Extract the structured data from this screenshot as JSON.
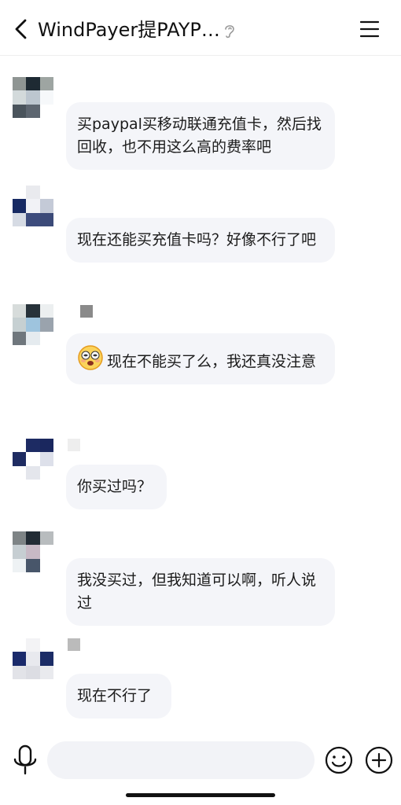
{
  "header": {
    "title": "WindPayer提PAYP…"
  },
  "messages": [
    {
      "text": "买paypal买移动联通充值卡，然后找回收，也不用这么高的费率吧",
      "avatar_colors": [
        "#8f9593",
        "#1e2a33",
        "#9ea5a2",
        "#d3dadb",
        "#bcc6cf",
        "#f6f8fa",
        "#4a545c",
        "#5d6670",
        "#ffffff"
      ]
    },
    {
      "text": "现在还能买充值卡吗？好像不行了吧",
      "avatar_colors": [
        "#ffffff",
        "#e9eaee",
        "#ffffff",
        "#172a63",
        "#f1f2f6",
        "#c4cad7",
        "#d6dbe4",
        "#3d4c7d",
        "#3b4a78"
      ]
    },
    {
      "text": "现在不能买了么，我还真没注意",
      "avatar_colors": [
        "#d7dcdb",
        "#27323a",
        "#eceff0",
        "#c6d0d2",
        "#9ec4de",
        "#9aa3ad",
        "#6f777d",
        "#e5ebef",
        "#ffffff"
      ]
    },
    {
      "text": "你买过吗？",
      "avatar_colors": [
        "#ffffff",
        "#1d2b63",
        "#1a275e",
        "#1f2c62",
        "#ffffff",
        "#dde0ea",
        "#ffffff",
        "#e4e6ec",
        "#ffffff"
      ]
    },
    {
      "text": "我没买过，但我知道可以啊，听人说过",
      "avatar_colors": [
        "#7e8486",
        "#222c35",
        "#b8bcbe",
        "#c6ced2",
        "#c7b9c5",
        "#ffffff",
        "#eef2f4",
        "#48566a",
        "#ffffff"
      ]
    },
    {
      "text": "现在不行了",
      "avatar_colors": [
        "#ffffff",
        "#f3f3f5",
        "#ffffff",
        "#1a2a6b",
        "#e8e9ee",
        "#1b2c66",
        "#e2e3e8",
        "#dcdde3",
        "#e9eaee"
      ]
    }
  ],
  "input": {
    "value": "",
    "placeholder": ""
  },
  "icons": {
    "back": "chevron-left-icon",
    "ear": "ear-icon",
    "menu": "hamburger-menu-icon",
    "mic": "microphone-icon",
    "emoji": "smiley-icon",
    "plus": "plus-circle-icon"
  }
}
